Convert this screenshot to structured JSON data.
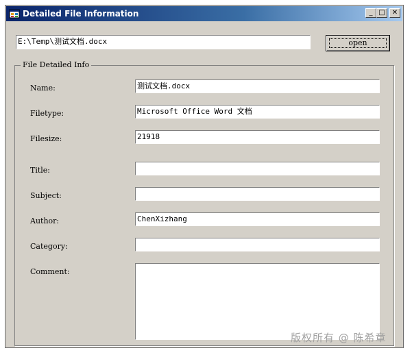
{
  "window": {
    "title": "Detailed File Information",
    "minimize_glyph": "_",
    "maximize_glyph": "□",
    "close_glyph": "✕"
  },
  "top": {
    "path_value": "E:\\Temp\\测试文档.docx",
    "open_label": "open"
  },
  "group": {
    "title": "File Detailed Info",
    "fields": {
      "name": {
        "label": "Name:",
        "value": "测试文档.docx"
      },
      "filetype": {
        "label": "Filetype:",
        "value": "Microsoft Office Word 文档"
      },
      "filesize": {
        "label": "Filesize:",
        "value": "21918"
      },
      "title": {
        "label": "Title:",
        "value": ""
      },
      "subject": {
        "label": "Subject:",
        "value": ""
      },
      "author": {
        "label": "Author:",
        "value": "ChenXizhang"
      },
      "category": {
        "label": "Category:",
        "value": ""
      },
      "comment": {
        "label": "Comment:",
        "value": ""
      }
    }
  },
  "watermark": "版权所有 @ 陈希章"
}
